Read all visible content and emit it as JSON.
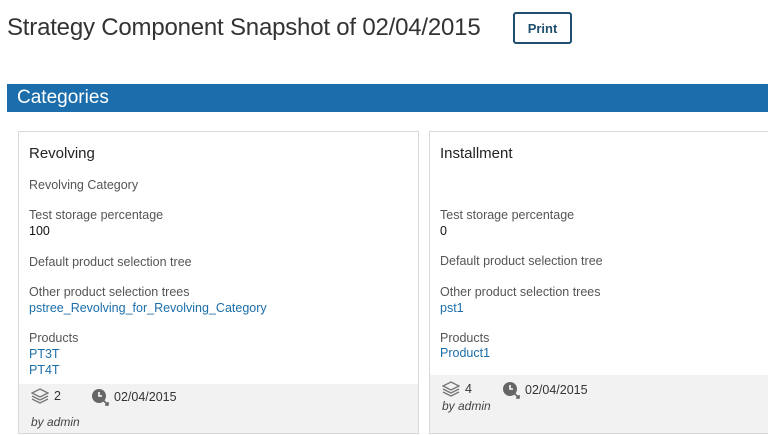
{
  "header": {
    "title": "Strategy Component Snapshot of 02/04/2015",
    "print_label": "Print"
  },
  "section": {
    "title": "Categories"
  },
  "cards": [
    {
      "title": "Revolving",
      "description": "Revolving Category",
      "test_storage_label": "Test storage percentage",
      "test_storage_value": "100",
      "default_tree_label": "Default product selection tree",
      "other_trees_label": "Other product selection trees",
      "other_trees": [
        "pstree_Revolving_for_Revolving_Category"
      ],
      "products_label": "Products",
      "products": [
        "PT3T",
        "PT4T"
      ],
      "version_count": "2",
      "date": "02/04/2015",
      "by": "by admin"
    },
    {
      "title": "Installment",
      "description": "",
      "test_storage_label": "Test storage percentage",
      "test_storage_value": "0",
      "default_tree_label": "Default product selection tree",
      "other_trees_label": "Other product selection trees",
      "other_trees": [
        "pst1"
      ],
      "products_label": "Products",
      "products": [
        "Product1"
      ],
      "version_count": "4",
      "date": "02/04/2015",
      "by": "by admin"
    }
  ],
  "icons": {
    "versions": "layers-icon",
    "date": "clock-history-icon"
  }
}
